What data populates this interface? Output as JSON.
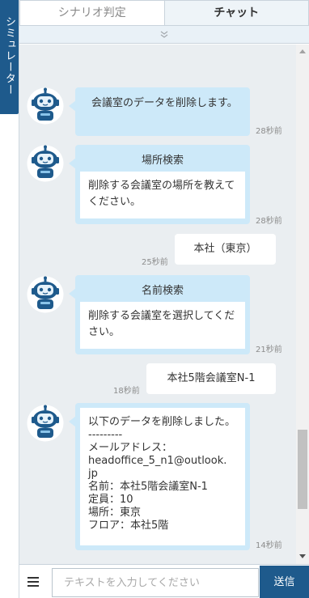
{
  "sidebar": {
    "label": "シミュレーター"
  },
  "tabs": [
    {
      "label": "シナリオ判定",
      "active": false
    },
    {
      "label": "チャット",
      "active": true
    }
  ],
  "colors": {
    "brand": "#1e5a8c",
    "bot_bubble": "#cde9f9",
    "chat_bg": "#eaeef1"
  },
  "messages": {
    "m1": {
      "text": "会議室のデータを削除します。",
      "time": "28秒前"
    },
    "m2": {
      "title": "場所検索",
      "text": "削除する会議室の場所を教えてください。",
      "time": "28秒前"
    },
    "m3": {
      "text": "本社（東京）",
      "time": "25秒前"
    },
    "m4": {
      "title": "名前検索",
      "text": "削除する会議室を選択してください。",
      "time": "21秒前"
    },
    "m5": {
      "text": "本社5階会議室N-1",
      "time": "18秒前"
    },
    "m6": {
      "lines": [
        "以下のデータを削除しました。",
        "---------",
        "メールアドレス：",
        "headoffice_5_n1@outlook.",
        "jp",
        "名前：本社5階会議室N-1",
        "定員：10",
        "場所：東京",
        "フロア：本社5階"
      ],
      "time": "14秒前"
    }
  },
  "footer": {
    "placeholder": "テキストを入力してください",
    "send_label": "送信"
  }
}
